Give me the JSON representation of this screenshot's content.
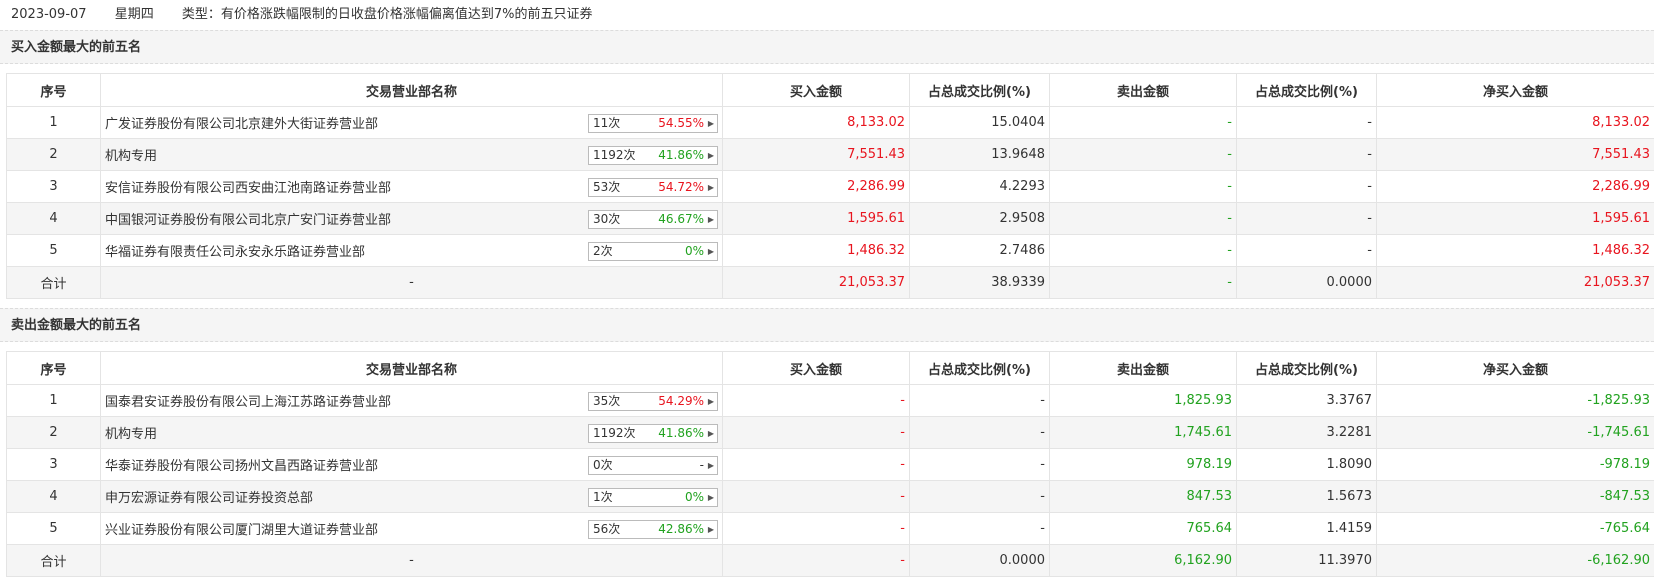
{
  "header": {
    "date": "2023-09-07",
    "weekday": "星期四",
    "type_label": "类型：有价格涨跌幅限制的日收盘价格涨幅偏离值达到7%的前五只证券"
  },
  "columns": [
    "序号",
    "交易营业部名称",
    "买入金额",
    "占总成交比例(%)",
    "卖出金额",
    "占总成交比例(%)",
    "净买入金额"
  ],
  "buy_section": {
    "title": "买入金额最大的前五名",
    "rows": [
      {
        "no": "1",
        "name": "广发证券股份有限公司北京建外大街证券营业部",
        "times": "11次",
        "rate": "54.55%",
        "buy": "8,133.02",
        "buy_pct": "15.0404",
        "sell": "-",
        "sell_pct": "-",
        "net": "8,133.02"
      },
      {
        "no": "2",
        "name": "机构专用",
        "times": "1192次",
        "rate": "41.86%",
        "buy": "7,551.43",
        "buy_pct": "13.9648",
        "sell": "-",
        "sell_pct": "-",
        "net": "7,551.43"
      },
      {
        "no": "3",
        "name": "安信证券股份有限公司西安曲江池南路证券营业部",
        "times": "53次",
        "rate": "54.72%",
        "buy": "2,286.99",
        "buy_pct": "4.2293",
        "sell": "-",
        "sell_pct": "-",
        "net": "2,286.99"
      },
      {
        "no": "4",
        "name": "中国银河证券股份有限公司北京广安门证券营业部",
        "times": "30次",
        "rate": "46.67%",
        "buy": "1,595.61",
        "buy_pct": "2.9508",
        "sell": "-",
        "sell_pct": "-",
        "net": "1,595.61"
      },
      {
        "no": "5",
        "name": "华福证券有限责任公司永安永乐路证券营业部",
        "times": "2次",
        "rate": "0%",
        "buy": "1,486.32",
        "buy_pct": "2.7486",
        "sell": "-",
        "sell_pct": "-",
        "net": "1,486.32"
      }
    ],
    "total": {
      "label": "合计",
      "name": "-",
      "buy": "21,053.37",
      "buy_pct": "38.9339",
      "sell": "-",
      "sell_pct": "0.0000",
      "net": "21,053.37"
    }
  },
  "sell_section": {
    "title": "卖出金额最大的前五名",
    "rows": [
      {
        "no": "1",
        "name": "国泰君安证券股份有限公司上海江苏路证券营业部",
        "times": "35次",
        "rate": "54.29%",
        "buy": "-",
        "buy_pct": "-",
        "sell": "1,825.93",
        "sell_pct": "3.3767",
        "net": "-1,825.93"
      },
      {
        "no": "2",
        "name": "机构专用",
        "times": "1192次",
        "rate": "41.86%",
        "buy": "-",
        "buy_pct": "-",
        "sell": "1,745.61",
        "sell_pct": "3.2281",
        "net": "-1,745.61"
      },
      {
        "no": "3",
        "name": "华泰证券股份有限公司扬州文昌西路证券营业部",
        "times": "0次",
        "rate": "-",
        "buy": "-",
        "buy_pct": "-",
        "sell": "978.19",
        "sell_pct": "1.8090",
        "net": "-978.19"
      },
      {
        "no": "4",
        "name": "申万宏源证券有限公司证券投资总部",
        "times": "1次",
        "rate": "0%",
        "buy": "-",
        "buy_pct": "-",
        "sell": "847.53",
        "sell_pct": "1.5673",
        "net": "-847.53"
      },
      {
        "no": "5",
        "name": "兴业证券股份有限公司厦门湖里大道证券营业部",
        "times": "56次",
        "rate": "42.86%",
        "buy": "-",
        "buy_pct": "-",
        "sell": "765.64",
        "sell_pct": "1.4159",
        "net": "-765.64"
      }
    ],
    "total": {
      "label": "合计",
      "name": "-",
      "buy": "-",
      "buy_pct": "0.0000",
      "sell": "6,162.90",
      "sell_pct": "11.3970",
      "net": "-6,162.90"
    }
  },
  "colors": {
    "up": "#e8141e",
    "down": "#21a21f"
  }
}
